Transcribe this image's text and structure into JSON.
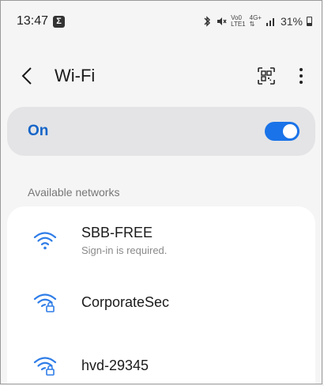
{
  "status_bar": {
    "time": "13:47",
    "notif_glyph": "Σ",
    "volte_top": "Vo0",
    "volte_bottom": "LTE1",
    "net_top": "4G+",
    "net_bottom": "⇅",
    "battery": "31%"
  },
  "header": {
    "title": "Wi-Fi"
  },
  "toggle": {
    "label": "On",
    "state": true,
    "color": "#1a73e8"
  },
  "available": {
    "section_label": "Available networks",
    "networks": [
      {
        "name": "SBB-FREE",
        "subtitle": "Sign-in is required.",
        "secured": false
      },
      {
        "name": "CorporateSec",
        "subtitle": "",
        "secured": true
      },
      {
        "name": "hvd-29345",
        "subtitle": "",
        "secured": true
      }
    ]
  },
  "colors": {
    "accent": "#1a73e8",
    "wifi_icon": "#2f7de8",
    "background": "#f5f5f5"
  }
}
